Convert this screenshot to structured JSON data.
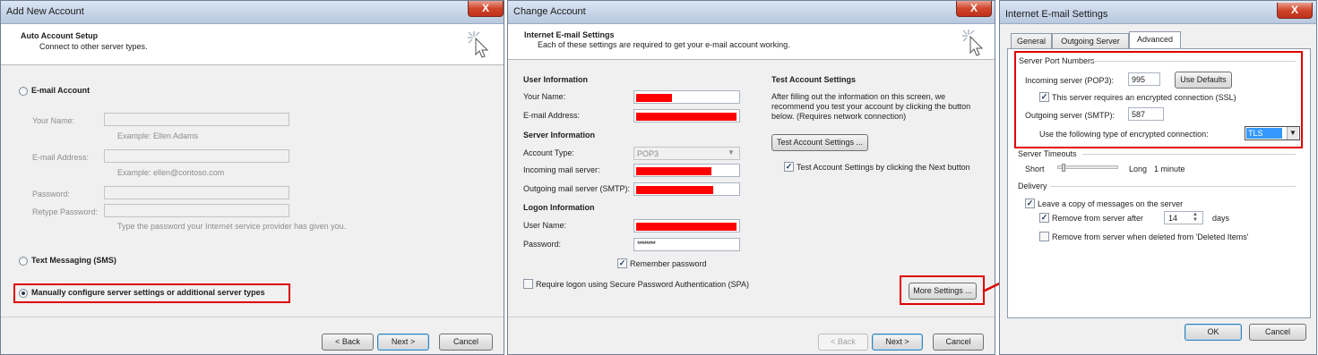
{
  "window1": {
    "title": "Add New Account",
    "close": "X",
    "header_title": "Auto Account Setup",
    "header_subtitle": "Connect to other server types.",
    "email_account": "E-mail Account",
    "your_name_label": "Your Name:",
    "your_name_example": "Example: Ellen Adams",
    "email_label": "E-mail Address:",
    "email_example": "Example: ellen@contoso.com",
    "password_label": "Password:",
    "retype_label": "Retype Password:",
    "password_hint": "Type the password your Internet service provider has given you.",
    "text_messaging": "Text Messaging (SMS)",
    "manual_config": "Manually configure server settings or additional server types",
    "back": "< Back",
    "next": "Next >",
    "cancel": "Cancel"
  },
  "window2": {
    "title": "Change Account",
    "close": "X",
    "header_title": "Internet E-mail Settings",
    "header_subtitle": "Each of these settings are required to get your e-mail account working.",
    "user_info": "User Information",
    "your_name": "Your Name:",
    "email_address": "E-mail Address:",
    "server_info": "Server Information",
    "account_type": "Account Type:",
    "account_type_value": "POP3",
    "incoming": "Incoming mail server:",
    "outgoing": "Outgoing mail server (SMTP):",
    "logon_info": "Logon Information",
    "user_name": "User Name:",
    "password": "Password:",
    "password_value": "********",
    "remember": "Remember password",
    "spa": "Require logon using Secure Password Authentication (SPA)",
    "test_title": "Test Account Settings",
    "test_desc_1": "After filling out the information on this screen, we",
    "test_desc_2": "recommend you test your account by clicking the button",
    "test_desc_3": "below. (Requires network connection)",
    "test_button": "Test Account Settings ...",
    "test_next": "Test Account Settings by clicking the Next button",
    "more_settings": "More Settings ...",
    "back": "< Back",
    "next": "Next >",
    "cancel": "Cancel"
  },
  "window3": {
    "title": "Internet E-mail Settings",
    "close": "X",
    "tabs": [
      "General",
      "Outgoing Server",
      "Advanced"
    ],
    "server_port_numbers": "Server Port Numbers",
    "incoming_label": "Incoming server (POP3):",
    "incoming_port": "995",
    "use_defaults": "Use Defaults",
    "ssl_label": "This server requires an encrypted connection (SSL)",
    "outgoing_label": "Outgoing server (SMTP):",
    "outgoing_port": "587",
    "encryption_label": "Use the following type of encrypted connection:",
    "encryption_value": "TLS",
    "server_timeouts": "Server Timeouts",
    "short": "Short",
    "long": "Long",
    "timeout_value": "1 minute",
    "delivery": "Delivery",
    "leave_copy": "Leave a copy of messages on the server",
    "remove_after": "Remove from server after",
    "days_value": "14",
    "days": "days",
    "remove_deleted": "Remove from server when deleted from 'Deleted Items'",
    "ok": "OK",
    "cancel": "Cancel"
  },
  "colors": {
    "highlight": "#e00000",
    "accent": "#3c7fb1"
  }
}
